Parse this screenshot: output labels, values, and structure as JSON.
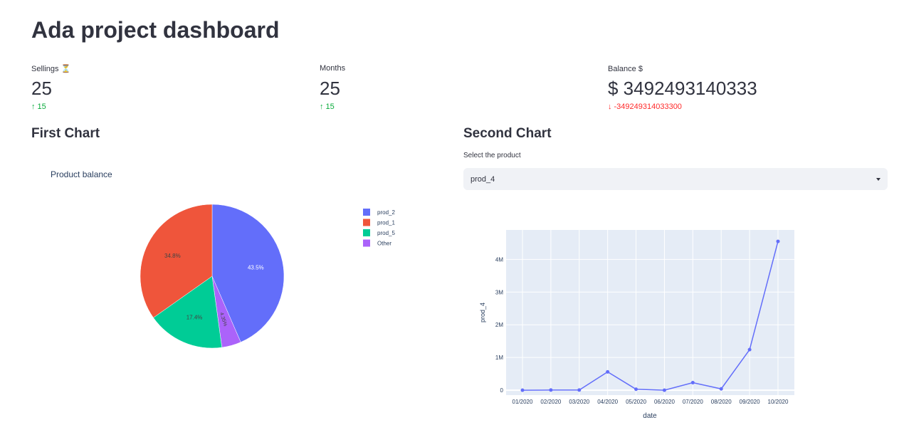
{
  "page": {
    "title": "Ada project dashboard"
  },
  "metrics": [
    {
      "label": "Sellings",
      "label_icon": "hourglass-icon",
      "value": "25",
      "delta": "15",
      "direction": "up"
    },
    {
      "label": "Months",
      "value": "25",
      "delta": "15",
      "direction": "up"
    },
    {
      "label": "Balance",
      "label_icon": "dollar-icon",
      "value": "$ 3492493140333",
      "delta": "-349249314033300",
      "direction": "down"
    }
  ],
  "colors": {
    "up": "#09ab3b",
    "down": "#ff2b2b",
    "line": "#636efa"
  },
  "first_chart": {
    "section_title": "First Chart",
    "chart_data": {
      "type": "pie",
      "title": "Product balance",
      "legend_position": "right",
      "slices": [
        {
          "label": "prod_2",
          "value": 43.5,
          "text": "43.5%",
          "color": "#636efa"
        },
        {
          "label": "prod_5",
          "value": 4.35,
          "text": "4.35%",
          "color": "#ab63fa",
          "legend_label": "Other"
        },
        {
          "label": "prod_5",
          "value": 17.4,
          "text": "17.4%",
          "color": "#00cc96"
        },
        {
          "label": "prod_1",
          "value": 34.8,
          "text": "34.8%",
          "color": "#ef553b"
        }
      ],
      "legend": [
        {
          "label": "prod_2",
          "color": "#636efa"
        },
        {
          "label": "prod_1",
          "color": "#ef553b"
        },
        {
          "label": "prod_5",
          "color": "#00cc96"
        },
        {
          "label": "Other",
          "color": "#ab63fa"
        }
      ]
    }
  },
  "second_chart": {
    "section_title": "Second Chart",
    "select_label": "Select the product",
    "select_value": "prod_4",
    "chart_data": {
      "type": "line",
      "xlabel": "date",
      "ylabel": "prod_4",
      "grid": true,
      "categories": [
        "01/2020",
        "02/2020",
        "03/2020",
        "04/2020",
        "05/2020",
        "06/2020",
        "07/2020",
        "08/2020",
        "09/2020",
        "10/2020"
      ],
      "values": [
        0,
        5000,
        5000,
        560000,
        30000,
        0,
        230000,
        40000,
        1240000,
        4550000
      ],
      "ylim": [
        -150000,
        4900000
      ],
      "yticks": [
        0,
        1000000,
        2000000,
        3000000,
        4000000
      ],
      "ytick_labels": [
        "0",
        "1M",
        "2M",
        "3M",
        "4M"
      ]
    }
  }
}
